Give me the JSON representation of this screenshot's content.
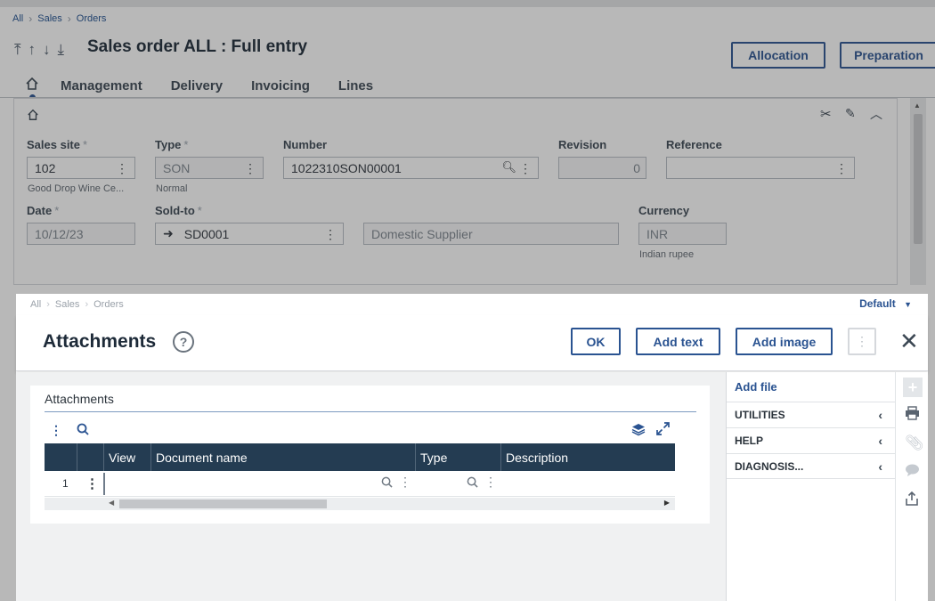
{
  "breadcrumb": {
    "items": [
      "All",
      "Sales",
      "Orders"
    ]
  },
  "page": {
    "title": "Sales order ALL : Full entry"
  },
  "header_buttons": {
    "allocation": "Allocation",
    "preparation": "Preparation"
  },
  "tabs": [
    "Management",
    "Delivery",
    "Invoicing",
    "Lines"
  ],
  "fields": {
    "sales_site": {
      "label": "Sales site",
      "value": "102",
      "sub": "Good Drop Wine Ce..."
    },
    "type": {
      "label": "Type",
      "value": "SON",
      "sub": "Normal"
    },
    "number": {
      "label": "Number",
      "value": "1022310SON00001"
    },
    "revision": {
      "label": "Revision",
      "value": "0"
    },
    "reference": {
      "label": "Reference",
      "value": ""
    },
    "date": {
      "label": "Date",
      "value": "10/12/23"
    },
    "sold_to": {
      "label": "Sold-to",
      "value": "SD0001",
      "name": "Domestic Supplier"
    },
    "currency": {
      "label": "Currency",
      "value": "INR",
      "sub": "Indian rupee"
    }
  },
  "dialog": {
    "breadcrumb": [
      "All",
      "Sales",
      "Orders"
    ],
    "view_selector": "Default",
    "title": "Attachments",
    "buttons": {
      "ok": "OK",
      "add_text": "Add text",
      "add_image": "Add image"
    },
    "section_title": "Attachments",
    "grid": {
      "columns": [
        "View",
        "Document name",
        "Type",
        "Description"
      ],
      "rows": [
        {
          "index": "1"
        }
      ]
    },
    "side": {
      "add_file": "Add file",
      "sections": [
        "UTILITIES",
        "HELP",
        "DIAGNOSIS..."
      ]
    }
  },
  "colors": {
    "accent": "#2a5391",
    "grid_header": "#243c52"
  }
}
